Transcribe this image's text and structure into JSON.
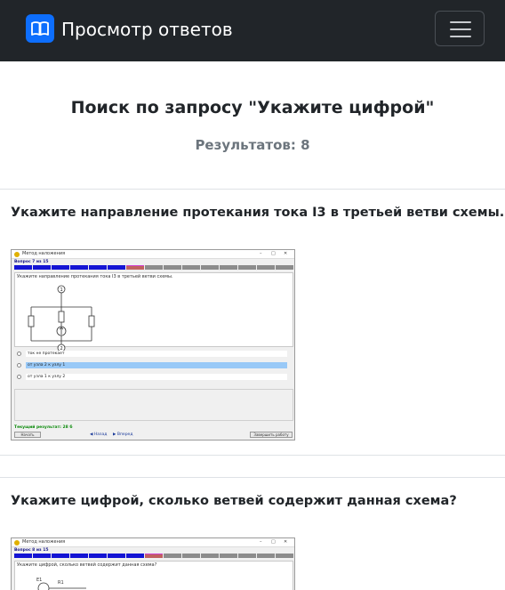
{
  "navbar": {
    "brand_icon": "book-icon",
    "brand_title": "Просмотр ответов",
    "menu_icon": "hamburger-menu-icon",
    "bg_color": "#212529",
    "accent_color": "#0d6efd"
  },
  "search": {
    "title": "Поиск по запросу \"Укажите цифрой\"",
    "results_label": "Результатов: 8"
  },
  "results": [
    {
      "question": "Укажите направление протекания тока I3 в третьей ветви схемы.",
      "screenshot": {
        "window_title": "Метод наложения",
        "question_counter": "Вопрос 7 из 15",
        "prompt": "Укажите направление протекания тока I3 в третьей ветви схемы.",
        "options": [
          "ток не протекает",
          "от узла 2 к узлу 1",
          "от узла 1 к узлу 2"
        ],
        "selected_index": 1,
        "status": "Текущий результат: 28 б",
        "back_label": "Назад",
        "forward_label": "Вперед",
        "submit_label": "Завершить работу",
        "start_label": "Начать"
      }
    },
    {
      "question": "Укажите цифрой, сколько ветвей содержит данная схема?",
      "screenshot": {
        "window_title": "Метод наложения",
        "question_counter": "Вопрос 8 из 15",
        "prompt": "Укажите цифрой, сколько ветвей содержит данная схема?",
        "labels": [
          "E1",
          "R1"
        ]
      }
    }
  ]
}
